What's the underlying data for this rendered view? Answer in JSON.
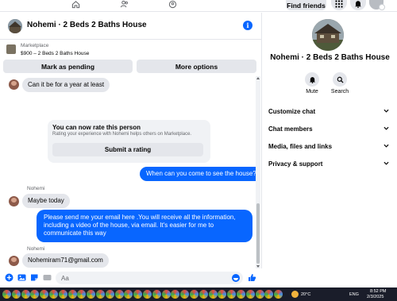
{
  "topbar": {
    "find_friends": "Find friends"
  },
  "chat": {
    "title": "Nohemi · 2 Beds 2 Baths House",
    "marketplace_label": "Marketplace",
    "listing": "$900 – 2 Beds 2 Baths House",
    "mark_pending": "Mark as pending",
    "more_options": "More options",
    "messages": {
      "msg1": "Can it be for a year at least",
      "rate_title": "You can now rate this person",
      "rate_sub": "Rating your experience with Nohemi helps others on Marketplace.",
      "rate_button": "Submit a rating",
      "msg2": "When can you come to see the house?",
      "sender1": "Nohemi",
      "msg3": "Maybe today",
      "msg4": "Please send me your email here .You will receive all the information, including a video of the house, via email. It's easier for me to communicate this way",
      "sender2": "Nohemi",
      "msg5": "Nohemiram71@gmail.com"
    },
    "composer_placeholder": "Aa",
    "accent_color": "#0866ff"
  },
  "panel": {
    "name": "Nohemi · 2 Beds 2 Baths House",
    "mute_label": "Mute",
    "search_label": "Search",
    "rows": [
      "Customize chat",
      "Chat members",
      "Media, files and links",
      "Privacy & support"
    ]
  },
  "taskbar": {
    "temperature": "20°C",
    "language": "ENG",
    "time": "8:52 PM",
    "date": "2/3/2025"
  }
}
